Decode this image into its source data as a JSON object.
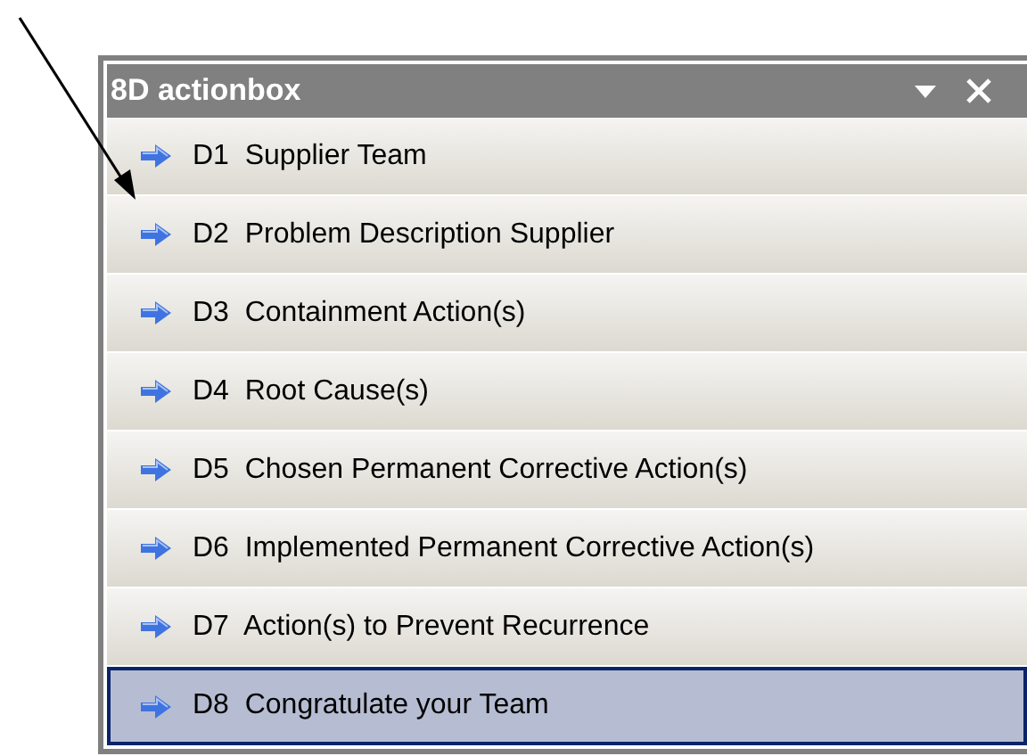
{
  "panel": {
    "title": "8D actionbox"
  },
  "items": [
    {
      "label": "D1  Supplier Team",
      "selected": false
    },
    {
      "label": "D2  Problem Description Supplier",
      "selected": false
    },
    {
      "label": "D3  Containment Action(s)",
      "selected": false
    },
    {
      "label": "D4  Root Cause(s)",
      "selected": false
    },
    {
      "label": "D5  Chosen Permanent Corrective Action(s)",
      "selected": false
    },
    {
      "label": "D6  Implemented Permanent Corrective Action(s)",
      "selected": false
    },
    {
      "label": "D7  Action(s) to Prevent Recurrence",
      "selected": false
    },
    {
      "label": "D8  Congratulate your Team",
      "selected": true
    }
  ]
}
